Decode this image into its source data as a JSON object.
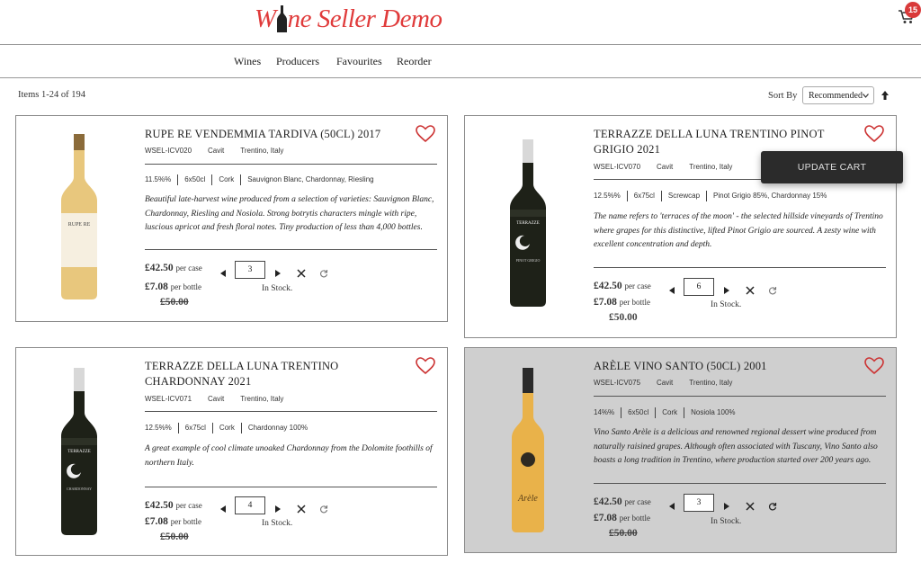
{
  "header": {
    "logo_text_1": "W",
    "logo_text_2": "ne Seller Demo",
    "cart_count": "15"
  },
  "nav": {
    "items": [
      "Wines",
      "Producers",
      "Favourites",
      "Reorder"
    ]
  },
  "listing": {
    "items_count": "Items 1-24 of 194",
    "sort_label": "Sort By",
    "sort_value": "Recommended"
  },
  "update_cart_label": "UPDATE CART",
  "products": [
    {
      "title": "RUPE RE VENDEMMIA TARDIVA (50CL) 2017",
      "sku": "WSEL-ICV020",
      "producer": "Cavit",
      "region": "Trentino, Italy",
      "specs": [
        "11.5%%",
        "6x50cl",
        "Cork",
        "Sauvignon Blanc, Chardonnay, Riesling"
      ],
      "description": "Beautiful late-harvest wine produced from a selection of varieties: Sauvignon Blanc, Chardonnay, Riesling and Nosiola. Strong botrytis characters mingle with ripe, luscious apricot and fresh floral notes. Tiny production of less than 4,000 bottles.",
      "price_case": "£42.50",
      "per_case": "per case",
      "price_bottle": "£7.08",
      "per_bottle": "per bottle",
      "price_old": "£50.00",
      "quantity": "3",
      "stock": "In Stock."
    },
    {
      "title": "TERRAZZE DELLA LUNA TRENTINO PINOT GRIGIO 2021",
      "sku": "WSEL-ICV070",
      "producer": "Cavit",
      "region": "Trentino, Italy",
      "specs": [
        "12.5%%",
        "6x75cl",
        "Screwcap",
        "Pinot Grigio 85%, Chardonnay 15%"
      ],
      "description": "The name refers to 'terraces of the moon' - the selected hillside vineyards of Trentino where grapes for this distinctive, lifted Pinot Grigio are sourced. A zesty wine with excellent concentration and depth.",
      "price_case": "£42.50",
      "per_case": "per case",
      "price_bottle": "£7.08",
      "per_bottle": "per bottle",
      "price_old": "£50.00",
      "quantity": "6",
      "stock": "In Stock."
    },
    {
      "title": "TERRAZZE DELLA LUNA TRENTINO CHARDONNAY 2021",
      "sku": "WSEL-ICV071",
      "producer": "Cavit",
      "region": "Trentino, Italy",
      "specs": [
        "12.5%%",
        "6x75cl",
        "Cork",
        "Chardonnay 100%"
      ],
      "description": "A great example of cool climate unoaked Chardonnay from the Dolomite foothills of northern Italy.",
      "price_case": "£42.50",
      "per_case": "per case",
      "price_bottle": "£7.08",
      "per_bottle": "per bottle",
      "price_old": "£50.00",
      "quantity": "4",
      "stock": "In Stock."
    },
    {
      "title": "ARÈLE VINO SANTO (50CL) 2001",
      "sku": "WSEL-ICV075",
      "producer": "Cavit",
      "region": "Trentino, Italy",
      "specs": [
        "14%%",
        "6x50cl",
        "Cork",
        "Nosiola 100%"
      ],
      "description": "Vino Santo Arèle is a delicious and renowned regional dessert wine produced from naturally raisined grapes. Although often associated with Tuscany, Vino Santo also boasts a long tradition in Trentino, where production started over 200 years ago.",
      "price_case": "£42.50",
      "per_case": "per case",
      "price_bottle": "£7.08",
      "per_bottle": "per bottle",
      "price_old": "£50.00",
      "quantity": "3",
      "stock": "In Stock."
    }
  ],
  "colors": {
    "brand_red": "#e03b3b",
    "badge_red": "#d93a3a",
    "highlight_card": "#cfcfcf",
    "update_cart_bg": "#2b2b2b"
  }
}
